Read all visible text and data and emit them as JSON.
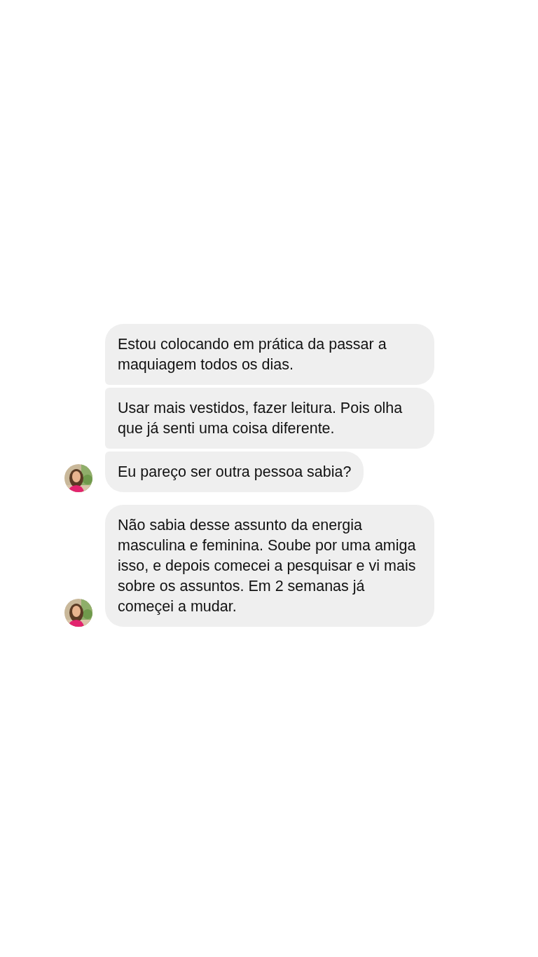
{
  "groups": [
    {
      "avatar": {
        "kind": "picture"
      },
      "messages": [
        {
          "text": "Estou colocando em prática da passar a maquiagem todos os dias."
        },
        {
          "text": "Usar mais vestidos, fazer leitura. Pois olha que já senti uma coisa diferente."
        },
        {
          "text": "Eu pareço ser outra pessoa sabia?"
        }
      ]
    },
    {
      "avatar": {
        "kind": "picture"
      },
      "messages": [
        {
          "text": "Não sabia desse assunto da energia masculina e feminina. Soube por uma amiga isso, e depois comecei a pesquisar e vi mais sobre os assuntos. Em 2 semanas já começei a mudar."
        }
      ]
    }
  ]
}
